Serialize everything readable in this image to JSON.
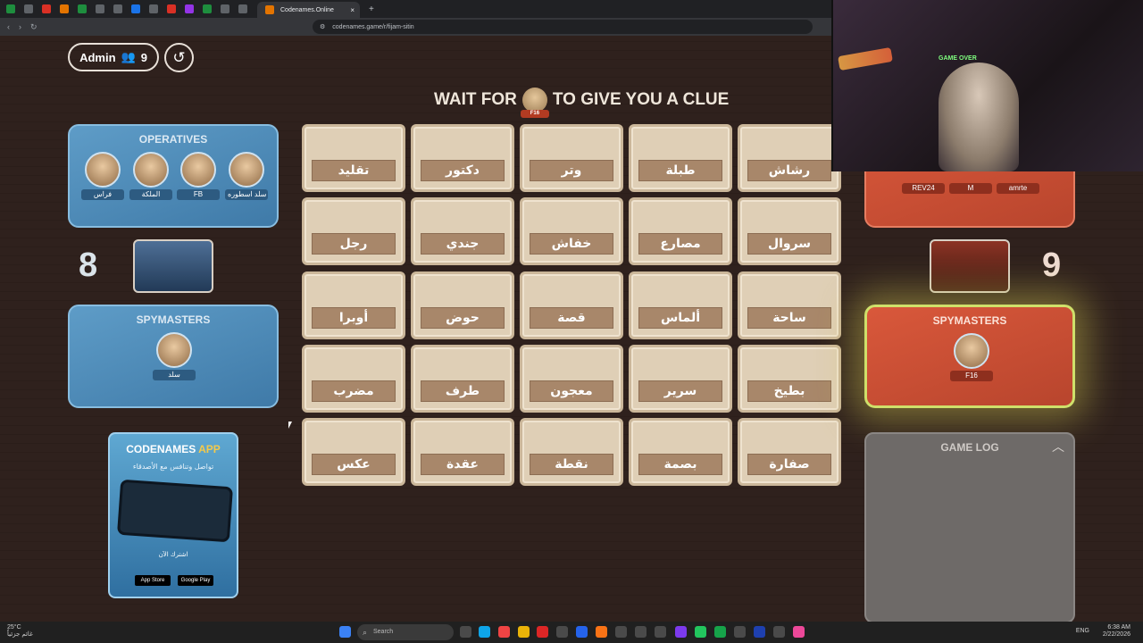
{
  "browser": {
    "active_tab_title": "Codenames.Online",
    "new_tab": "+",
    "close_tab": "×",
    "url": "codenames.game/r/fijam-sitin"
  },
  "header": {
    "admin_label": "Admin",
    "player_count": "9",
    "clue_prefix": "WAIT FOR",
    "clue_player": "F16",
    "clue_suffix": "TO GIVE YOU A CLUE"
  },
  "blue_team": {
    "score": "8",
    "operatives_title": "OPERATIVES",
    "operatives": [
      "فراس",
      "الملكة",
      "FB",
      "سلد اسطوره"
    ],
    "spymasters_title": "SPYMASTERS",
    "spymasters": [
      "سلد"
    ]
  },
  "red_team": {
    "score": "9",
    "operatives": [
      "REV24",
      "M",
      "amrte"
    ],
    "spymasters_title": "SPYMASTERS",
    "spymasters": [
      "F16"
    ]
  },
  "board": {
    "words": [
      "تقليد",
      "دكتور",
      "وتر",
      "طبلة",
      "رشاش",
      "رجل",
      "جندي",
      "خفاش",
      "مصارع",
      "سروال",
      "أوبرا",
      "حوض",
      "قصة",
      "ألماس",
      "ساحة",
      "مضرب",
      "طرف",
      "معجون",
      "سرير",
      "بطيخ",
      "عكس",
      "عقدة",
      "نقطة",
      "بصمة",
      "صفارة"
    ]
  },
  "ad": {
    "title_a": "CODENAMES ",
    "title_b": "APP",
    "subtitle": "تواصل وتنافس مع الأصدقاء",
    "cta": "اشترك الآن",
    "app_store": "App Store",
    "google_play": "Google Play"
  },
  "game_log": {
    "title": "GAME LOG"
  },
  "webcam": {
    "sign": "GAME OVER"
  },
  "taskbar": {
    "temperature": "25°C",
    "weather_text": "غائم جزئياً",
    "search_placeholder": "Search",
    "language": "ENG",
    "time": "6:38 AM",
    "date": "2/22/2026"
  }
}
